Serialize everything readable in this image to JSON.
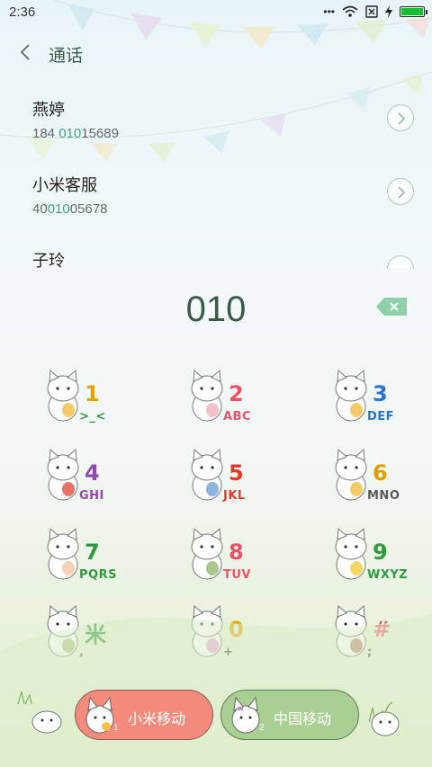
{
  "status_bar": {
    "time": "2:36",
    "icons": [
      "dots-icon",
      "wifi-icon",
      "sim-off-icon",
      "charging-icon",
      "battery-icon"
    ],
    "battery_level": 1.0,
    "battery_color": "#12c12b"
  },
  "header": {
    "title": "通话",
    "back_icon": "chevron-left-icon"
  },
  "contacts": [
    {
      "name": "燕婷",
      "number_parts": [
        "184 ",
        "010",
        "15689"
      ]
    },
    {
      "name": "小米客服",
      "number_parts": [
        "40",
        "010",
        "05678"
      ]
    },
    {
      "name": "子玲",
      "number_parts": []
    }
  ],
  "dial": {
    "input": "010",
    "backspace_icon": "backspace-icon"
  },
  "keypad": [
    {
      "digit": "1",
      "letters": ">_<",
      "digit_color": "#e4a400",
      "letters_color": "#2f9a3f"
    },
    {
      "digit": "2",
      "letters": "ABC",
      "digit_color": "#e8546a",
      "letters_color": "#e8546a"
    },
    {
      "digit": "3",
      "letters": "DEF",
      "digit_color": "#2b74c9",
      "letters_color": "#2b74c9"
    },
    {
      "digit": "4",
      "letters": "GHI",
      "digit_color": "#8e4ab0",
      "letters_color": "#8e4ab0"
    },
    {
      "digit": "5",
      "letters": "JKL",
      "digit_color": "#e23c2c",
      "letters_color": "#e23c2c"
    },
    {
      "digit": "6",
      "letters": "MNO",
      "digit_color": "#e0a000",
      "letters_color": "#5a5a5a"
    },
    {
      "digit": "7",
      "letters": "PQRS",
      "digit_color": "#2f9a3f",
      "letters_color": "#2f9a3f"
    },
    {
      "digit": "8",
      "letters": "TUV",
      "digit_color": "#e8546a",
      "letters_color": "#e8546a"
    },
    {
      "digit": "9",
      "letters": "WXYZ",
      "digit_color": "#2f9a3f",
      "letters_color": "#2f9a3f"
    },
    {
      "digit": "米",
      "letters": ",",
      "digit_color": "#2f9a3f",
      "letters_color": "#2f9a3f"
    },
    {
      "digit": "0",
      "letters": "+",
      "digit_color": "#e4a400",
      "letters_color": "#444444"
    },
    {
      "digit": "#",
      "letters": ";",
      "digit_color": "#e8546a",
      "letters_color": "#444444"
    }
  ],
  "sim_buttons": [
    {
      "label": "小米移动",
      "slot": "1",
      "color": "#f58b7d"
    },
    {
      "label": "中国移动",
      "slot": "2",
      "color": "#a9cf93"
    }
  ]
}
